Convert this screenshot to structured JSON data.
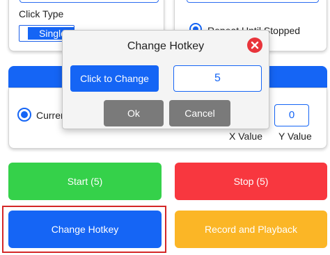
{
  "click_type": {
    "label": "Click Type",
    "selected": "Single"
  },
  "repeat": {
    "label": "Repeat Until Stopped",
    "selected": true
  },
  "location": {
    "current_label": "Curren",
    "selected": true,
    "x_label": "X Value",
    "y_label": "Y Value",
    "y_value": "0"
  },
  "dialog": {
    "title": "Change Hotkey",
    "click_to_change_label": "Click to Change",
    "hotkey_value": "5",
    "ok_label": "Ok",
    "cancel_label": "Cancel"
  },
  "buttons": {
    "start_label": "Start (5)",
    "stop_label": "Stop (5)",
    "change_hotkey_label": "Change Hotkey",
    "record_label": "Record and Playback"
  },
  "colors": {
    "accent_blue": "#1565f5",
    "start_green": "#35d14a",
    "stop_red": "#f8373f",
    "record_orange": "#fbb626",
    "dialog_button_gray": "#7a7a7a",
    "highlight_red": "#d42727"
  },
  "icons": {
    "close": "close-icon"
  }
}
